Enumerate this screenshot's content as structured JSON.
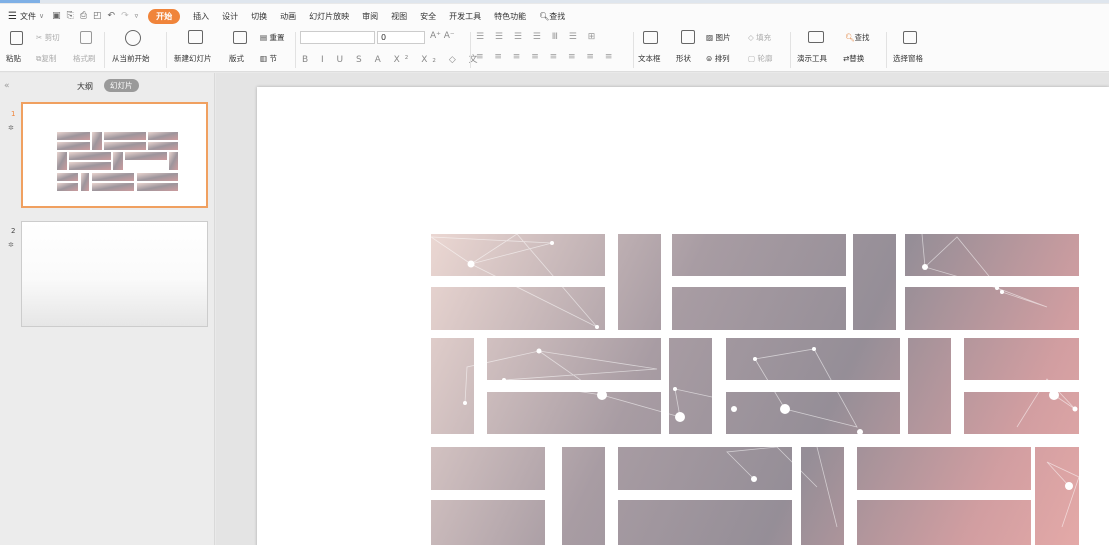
{
  "menu": {
    "file": "文件",
    "tabs": [
      "开始",
      "插入",
      "设计",
      "切换",
      "动画",
      "幻灯片放映",
      "审阅",
      "视图",
      "安全",
      "开发工具",
      "特色功能"
    ],
    "active": "开始",
    "search": "查找"
  },
  "ribbon": {
    "paste": "粘贴",
    "cut": "剪切",
    "copy": "复制",
    "format_painter": "格式刷",
    "from_current": "从当前开始",
    "new_slide": "新建幻灯片",
    "layout": "版式",
    "reset": "重置",
    "section": "节",
    "font_size": "0",
    "textbox": "文本框",
    "shape": "形状",
    "picture": "图片",
    "fill": "填充",
    "arrange": "排列",
    "outline": "轮廓",
    "present_tools": "演示工具",
    "find": "查找",
    "replace": "替换",
    "select_pane": "选择窗格"
  },
  "panel": {
    "collapse_glyph": "«",
    "outline_tab": "大纲",
    "slides_tab": "幻灯片",
    "slides": [
      {
        "num": "1",
        "star": "✲"
      },
      {
        "num": "2",
        "star": "✲"
      }
    ]
  },
  "colors": {
    "accent": "#f0843a",
    "thumb_selected_border": "#f0a060"
  }
}
